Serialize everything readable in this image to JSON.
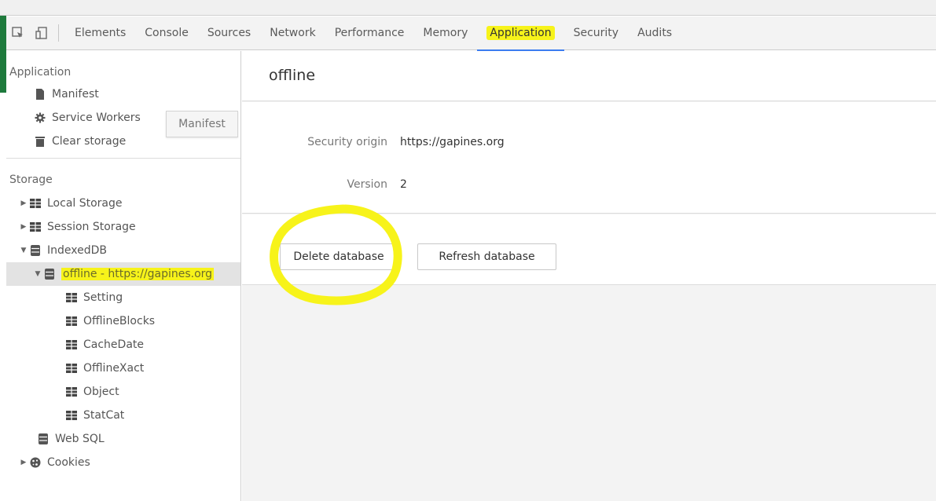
{
  "toolbar": {
    "tabs": [
      {
        "label": "Elements"
      },
      {
        "label": "Console"
      },
      {
        "label": "Sources"
      },
      {
        "label": "Network"
      },
      {
        "label": "Performance"
      },
      {
        "label": "Memory"
      },
      {
        "label": "Application"
      },
      {
        "label": "Security"
      },
      {
        "label": "Audits"
      }
    ],
    "active_tab": "Application"
  },
  "sidebar": {
    "application": {
      "title": "Application",
      "items": [
        {
          "label": "Manifest",
          "icon": "document-icon"
        },
        {
          "label": "Service Workers",
          "icon": "gear-icon"
        },
        {
          "label": "Clear storage",
          "icon": "trash-icon"
        }
      ]
    },
    "tooltip": "Manifest",
    "storage": {
      "title": "Storage",
      "local_storage": "Local Storage",
      "session_storage": "Session Storage",
      "indexeddb": "IndexedDB",
      "database": "offline - https://gapines.org",
      "stores": [
        "Setting",
        "OfflineBlocks",
        "CacheDate",
        "OfflineXact",
        "Object",
        "StatCat"
      ],
      "web_sql": "Web SQL",
      "cookies": "Cookies"
    }
  },
  "main": {
    "title": "offline",
    "security_origin_label": "Security origin",
    "security_origin_value": "https://gapines.org",
    "version_label": "Version",
    "version_value": "2",
    "delete_button": "Delete database",
    "refresh_button": "Refresh database"
  },
  "colors": {
    "highlight": "#f7f31a",
    "active_tab_underline": "#3b7cf0",
    "accent_green": "#1e7a3c"
  }
}
